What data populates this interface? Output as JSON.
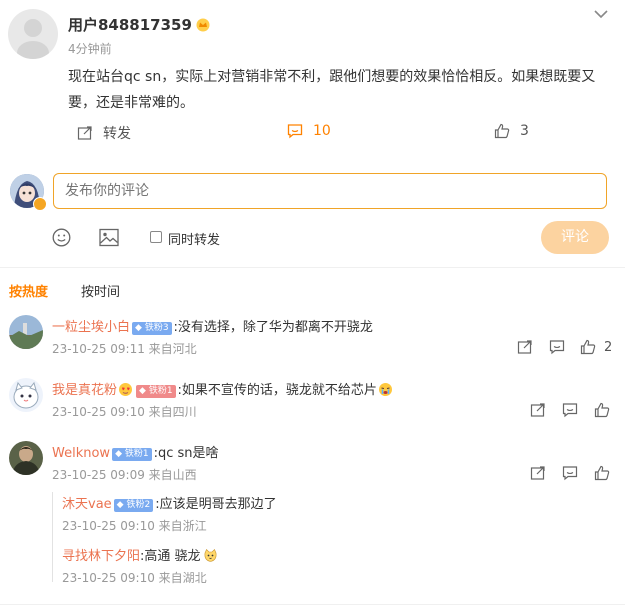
{
  "post": {
    "username": "用户848817359",
    "crown_icon": "gold-crown-icon",
    "time": "4分钟前",
    "content": "现在站台qc sn，实际上对营销非常不利，跟他们想要的效果恰恰相反。如果想既要又要，还是非常难的。",
    "actions": {
      "repost_label": "转发",
      "comment_count": "10",
      "like_count": "3"
    }
  },
  "composer": {
    "placeholder": "发布你的评论",
    "repost_also_label": "同时转发",
    "submit_label": "评论",
    "accent_color": "#f0a428"
  },
  "sort": {
    "hot_label": "按热度",
    "time_label": "按时间"
  },
  "comments": [
    {
      "name": "一粒尘埃小白",
      "badge": "铁粉3",
      "text": ":没有选择，除了华为都离不开骁龙",
      "meta": "23-10-25 09:11 来自河北",
      "like_count": "2"
    },
    {
      "name": "我是真花粉",
      "badge": "铁粉1",
      "text": ":如果不宣传的话，骁龙就不给芯片",
      "meta": "23-10-25 09:10 来自四川",
      "like_count": ""
    },
    {
      "name": "Welknow",
      "badge": "铁粉1",
      "text": ":qc sn是啥",
      "meta": "23-10-25 09:09 来自山西",
      "like_count": ""
    }
  ],
  "replies": [
    {
      "name": "沐天vae",
      "badge": "铁粉2",
      "text": ":应该是明哥去那边了",
      "meta": "23-10-25 09:10 来自浙江"
    },
    {
      "name": "寻找林下夕阳",
      "text": ":高通 骁龙",
      "meta": "23-10-25 09:10 来自湖北"
    }
  ]
}
